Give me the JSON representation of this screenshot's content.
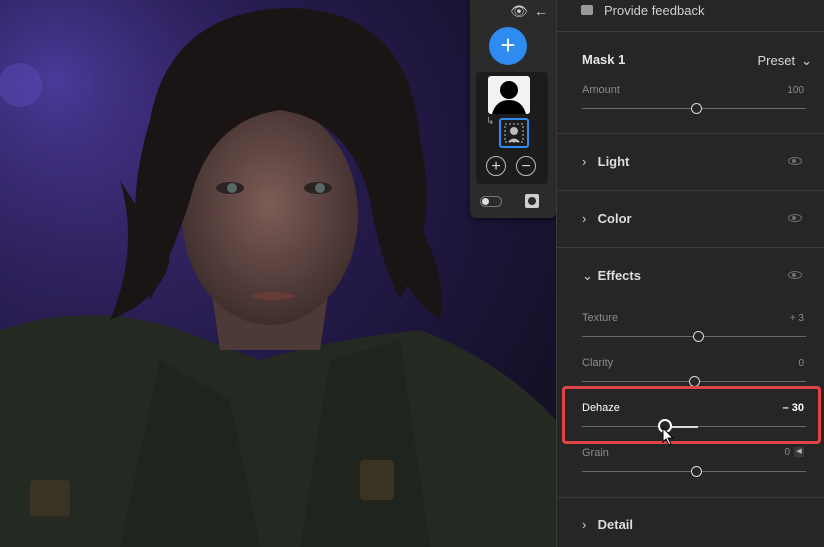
{
  "feedback": {
    "label": "Provide feedback"
  },
  "mask": {
    "title": "Mask 1",
    "preset_label": "Preset",
    "amount": {
      "label": "Amount",
      "value": "100",
      "fraction": 0.51
    }
  },
  "sections": {
    "light": {
      "label": "Light"
    },
    "color": {
      "label": "Color"
    },
    "effects": {
      "label": "Effects"
    },
    "detail": {
      "label": "Detail"
    }
  },
  "effects": {
    "texture": {
      "label": "Texture",
      "value": "+ 3",
      "fraction": 0.52
    },
    "clarity": {
      "label": "Clarity",
      "value": "0",
      "fraction": 0.5
    },
    "dehaze": {
      "label": "Dehaze",
      "value": "– 30",
      "fraction": 0.37
    },
    "grain": {
      "label": "Grain",
      "value": "0",
      "fraction": 0.51
    }
  },
  "mask_panel": {
    "add_label": "+",
    "add_mask_label": "+",
    "subtract_mask_label": "−"
  },
  "colors": {
    "accent": "#2e8bf0",
    "highlight": "#e04444"
  }
}
